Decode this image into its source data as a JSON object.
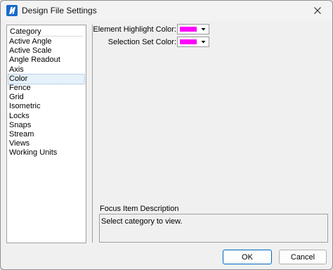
{
  "window": {
    "title": "Design File Settings"
  },
  "category": {
    "header": "Category",
    "items": [
      {
        "label": "Active Angle",
        "selected": false
      },
      {
        "label": "Active Scale",
        "selected": false
      },
      {
        "label": "Angle Readout",
        "selected": false
      },
      {
        "label": "Axis",
        "selected": false
      },
      {
        "label": "Color",
        "selected": true
      },
      {
        "label": "Fence",
        "selected": false
      },
      {
        "label": "Grid",
        "selected": false
      },
      {
        "label": "Isometric",
        "selected": false
      },
      {
        "label": "Locks",
        "selected": false
      },
      {
        "label": "Snaps",
        "selected": false
      },
      {
        "label": "Stream",
        "selected": false
      },
      {
        "label": "Views",
        "selected": false
      },
      {
        "label": "Working Units",
        "selected": false
      }
    ]
  },
  "settings": {
    "element_highlight": {
      "label": "Element Highlight Color:",
      "color": "#ff00ff"
    },
    "selection_set": {
      "label": "Selection Set Color:",
      "color": "#ff00ff"
    }
  },
  "focus": {
    "label": "Focus Item Description",
    "text": "Select category to view."
  },
  "buttons": {
    "ok": "OK",
    "cancel": "Cancel"
  },
  "colors": {
    "accent": "#0067c0",
    "selection_bg": "#e5f1fb"
  }
}
